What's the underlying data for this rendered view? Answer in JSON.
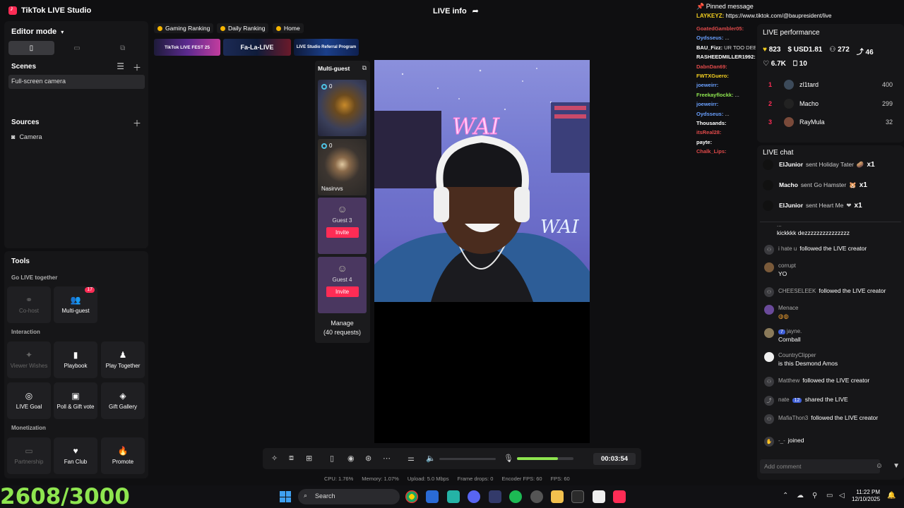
{
  "app": {
    "title": "TikTok LIVE Studio",
    "center_title": "LIVE info"
  },
  "editor": {
    "mode_label": "Editor mode",
    "scenes_title": "Scenes",
    "scene_items": [
      "Full-screen camera"
    ],
    "sources_title": "Sources",
    "source_items": [
      "Camera"
    ]
  },
  "tools": {
    "title": "Tools",
    "groups": {
      "go_live_together": "Go LIVE together",
      "interaction": "Interaction",
      "monetization": "Monetization"
    },
    "cohost": "Co-host",
    "multiguest": "Multi-guest",
    "multiguest_badge": "17",
    "viewer_wishes": "Viewer Wishes",
    "playbook": "Playbook",
    "play_together": "Play Together",
    "live_goal": "LIVE Goal",
    "poll_gift_vote": "Poll & Gift vote",
    "gift_gallery": "Gift Gallery",
    "partnership": "Partnership",
    "fan_club": "Fan Club",
    "promote": "Promote"
  },
  "tags": [
    "Gaming Ranking",
    "Daily Ranking",
    "Home"
  ],
  "promos": {
    "fest": "TikTok LIVE FEST 25",
    "falala": "Fa-La-LIVE",
    "referral": "LIVE Studio Referral Program"
  },
  "multi_guest": {
    "title": "Multi-guest",
    "guest1_count": "0",
    "guest2_count": "0",
    "guest2_name": "Nasirvvs",
    "guest3": "Guest 3",
    "guest4": "Guest 4",
    "invite": "Invite",
    "manage": "Manage",
    "requests": "(40 requests)"
  },
  "controls": {
    "timer": "00:03:54",
    "volume_level": 0.72
  },
  "stats": {
    "cpu": "CPU:  1.76%",
    "memory": "Memory:  1.07%",
    "upload": "Upload:  5.0 Mbps",
    "frame_drops": "Frame drops:  0",
    "encoder_fps": "Encoder FPS:  60",
    "fps": "FPS:  60"
  },
  "pinned": {
    "title": "Pinned message",
    "user": "LAYKEYZ:",
    "text": "https://www.tiktok.com/@baupresident/live"
  },
  "side_chat": [
    {
      "user": "GoatedGambler05:",
      "text": "",
      "color": "#e04a4a"
    },
    {
      "user": "Oydsseus:",
      "text": "...",
      "color": "#6aa0ff"
    },
    {
      "user": "BAU_Fizz:",
      "text": "UR TOO DEEP IN",
      "color": "#ffffff"
    },
    {
      "user": "RASHEEDMILLER1992:",
      "text": "",
      "color": "#ffffff"
    },
    {
      "user": "DabnDan69:",
      "text": "",
      "color": "#e04a4a"
    },
    {
      "user": "FWTXGuero:",
      "text": "",
      "color": "#f5d020"
    },
    {
      "user": "joeweirr:",
      "text": "",
      "color": "#6aa0ff"
    },
    {
      "user": "Freekayflockk:",
      "text": "...",
      "color": "#8ee54f"
    },
    {
      "user": "joeweirr:",
      "text": "",
      "color": "#6aa0ff"
    },
    {
      "user": "Oydsseus:",
      "text": "...",
      "color": "#6aa0ff"
    },
    {
      "user": "Thousands:",
      "text": "",
      "color": "#ffffff"
    },
    {
      "user": "itsReal28:",
      "text": "",
      "color": "#e04a4a"
    },
    {
      "user": "payte:",
      "text": "",
      "color": "#ffffff"
    },
    {
      "user": "Chalk_Lips:",
      "text": "",
      "color": "#e04a4a"
    }
  ],
  "performance": {
    "title": "LIVE performance",
    "likes_hearts": "823",
    "usd": "USD1.81",
    "viewers": "272",
    "shares": "46",
    "likes": "6.7K",
    "gifts": "10",
    "ranking": [
      {
        "n": "1",
        "name": "zl1tard",
        "score": "400"
      },
      {
        "n": "2",
        "name": "Macho",
        "score": "299"
      },
      {
        "n": "3",
        "name": "RayMula",
        "score": "32"
      }
    ]
  },
  "chat": {
    "title": "LIVE chat",
    "gifts": [
      {
        "user": "ElJunior",
        "action": "sent Holiday Tater",
        "mult": "x1"
      },
      {
        "user": "Macho",
        "action": "sent Go Hamster",
        "mult": "x1"
      },
      {
        "user": "ElJunior",
        "action": "sent Heart Me",
        "mult": "x1"
      }
    ],
    "partial_top": "...",
    "partial_text": "kickkkk dezzzzzzzzzzzzzzz",
    "row1_user": "i hate u",
    "row1_text": "followed the LIVE creator",
    "row2_user": "corrupt",
    "row2_text": "YO",
    "row3_user": "CHEESELEEK",
    "row3_text": "followed the LIVE creator",
    "row4_user": "Menace",
    "row5_badge": "7",
    "row5_user": "jayne.",
    "row5_text": "Cornball",
    "row6_user": "CountryClipper",
    "row6_text": "is this Desmond Amos",
    "row7_user": "Matthew",
    "row7_text": "followed the LIVE creator",
    "row8_user": "nate",
    "row8_badge": "12",
    "row8_text": "shared the LIVE",
    "row9_user": "MafiaThon3",
    "row9_text": "followed the LIVE creator",
    "row10_user": "-_-",
    "row10_text": "joined",
    "placeholder": "Add comment"
  },
  "overlay_counter": "2608/3000",
  "taskbar": {
    "search": "Search",
    "time": "11:22 PM",
    "date": "12/10/2025"
  }
}
